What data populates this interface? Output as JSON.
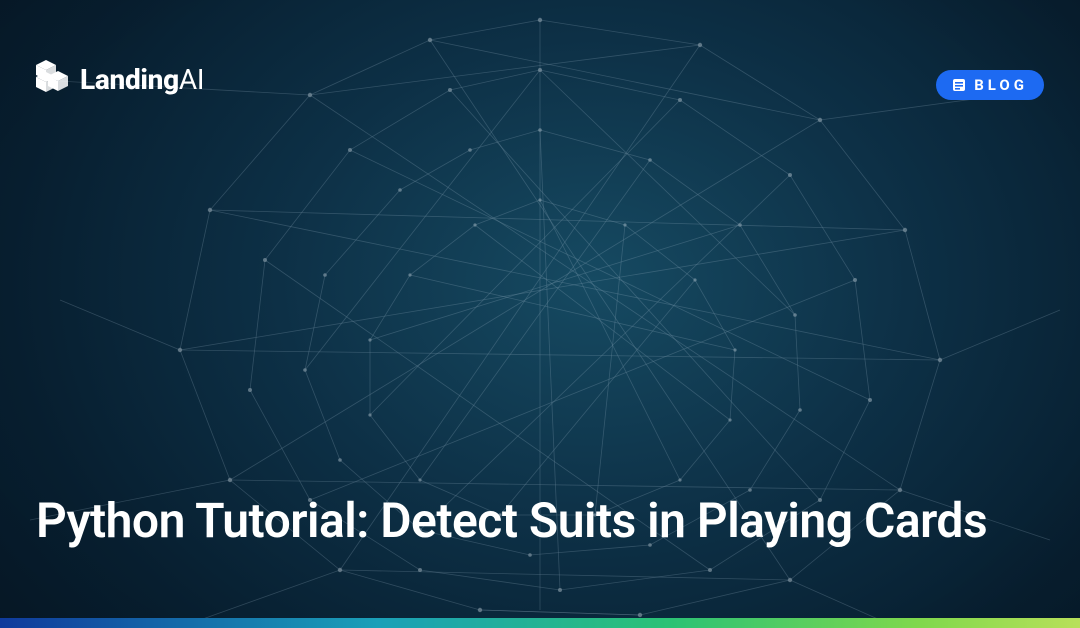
{
  "brand": {
    "name_bold": "Landing",
    "name_light": "AI"
  },
  "badge": {
    "label": "BLOG"
  },
  "hero": {
    "title": "Python Tutorial: Detect Suits in Playing Cards"
  },
  "colors": {
    "badge_bg": "#1d6af2",
    "gradient_stops": [
      "#0f3a9c",
      "#1aa0b8",
      "#2bc275",
      "#7fd84c",
      "#b8e05a"
    ]
  }
}
